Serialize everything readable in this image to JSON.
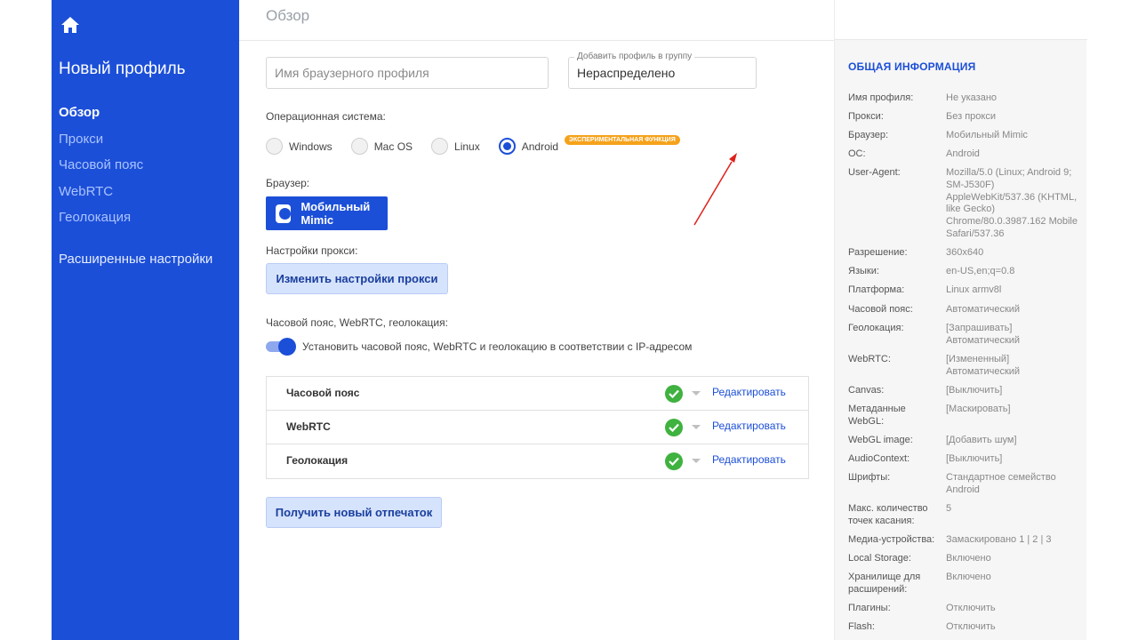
{
  "sidebar": {
    "title": "Новый профиль",
    "items": [
      {
        "label": "Обзор",
        "active": true
      },
      {
        "label": "Прокси",
        "active": false
      },
      {
        "label": "Часовой пояс",
        "active": false
      },
      {
        "label": "WebRTC",
        "active": false
      },
      {
        "label": "Геолокация",
        "active": false
      }
    ],
    "advanced": "Расширенные настройки"
  },
  "main": {
    "title": "Обзор",
    "profile_name_placeholder": "Имя браузерного профиля",
    "group_label": "Добавить профиль в группу",
    "group_value": "Нераспределено",
    "os_label": "Операционная система:",
    "os_options": [
      "Windows",
      "Mac OS",
      "Linux",
      "Android"
    ],
    "os_selected": "Android",
    "experimental_badge": "ЭКСПЕРИМЕНТАЛЬНАЯ ФУНКЦИЯ",
    "browser_label": "Браузер:",
    "browser_button": "Мобильный Mimic",
    "proxy_label": "Настройки прокси:",
    "proxy_button": "Изменить настройки прокси",
    "tz_label": "Часовой пояс, WebRTC, геолокация:",
    "toggle_text": "Установить часовой пояс, WebRTC и геолокацию в соответствии с IP-адресом",
    "table_rows": [
      {
        "name": "Часовой пояс",
        "action": "Редактировать"
      },
      {
        "name": "WebRTC",
        "action": "Редактировать"
      },
      {
        "name": "Геолокация",
        "action": "Редактировать"
      }
    ],
    "fingerprint_button": "Получить новый отпечаток"
  },
  "info": {
    "title": "ОБЩАЯ ИНФОРМАЦИЯ",
    "rows": [
      {
        "key": "Имя профиля:",
        "value": "Не указано"
      },
      {
        "key": "Прокси:",
        "value": "Без прокси"
      },
      {
        "key": "Браузер:",
        "value": "Мобильный Mimic"
      },
      {
        "key": "ОС:",
        "value": "Android"
      },
      {
        "key": "User-Agent:",
        "value": "Mozilla/5.0 (Linux; Android 9; SM-J530F) AppleWebKit/537.36 (KHTML, like Gecko) Chrome/80.0.3987.162 Mobile Safari/537.36"
      },
      {
        "key": "Разрешение:",
        "value": "360x640"
      },
      {
        "key": "Языки:",
        "value": "en-US,en;q=0.8"
      },
      {
        "key": "Платформа:",
        "value": "Linux armv8l"
      },
      {
        "key": "Часовой пояс:",
        "value": "Автоматический"
      },
      {
        "key": "Геолокация:",
        "value": "[Запрашивать] Автоматический"
      },
      {
        "key": "WebRTC:",
        "value": "[Измененный] Автоматический"
      },
      {
        "key": "Canvas:",
        "value": "[Выключить]"
      },
      {
        "key": "Метаданные WebGL:",
        "value": "[Маскировать]"
      },
      {
        "key": "WebGL image:",
        "value": "[Добавить шум]"
      },
      {
        "key": "AudioContext:",
        "value": "[Выключить]"
      },
      {
        "key": "Шрифты:",
        "value": "Стандартное семейство Android"
      },
      {
        "key": "Макс. количество точек касания:",
        "value": "5"
      },
      {
        "key": "Медиа-устройства:",
        "value": "Замаскировано 1 | 2 | 3"
      },
      {
        "key": "Local Storage:",
        "value": "Включено"
      },
      {
        "key": "Хранилище для расширений:",
        "value": "Включено"
      },
      {
        "key": "Плагины:",
        "value": "Отключить"
      },
      {
        "key": "Flash:",
        "value": "Отключить"
      }
    ]
  },
  "colors": {
    "brand": "#1c4fd8",
    "badge": "#f5a21b",
    "ok": "#3fb23f"
  }
}
